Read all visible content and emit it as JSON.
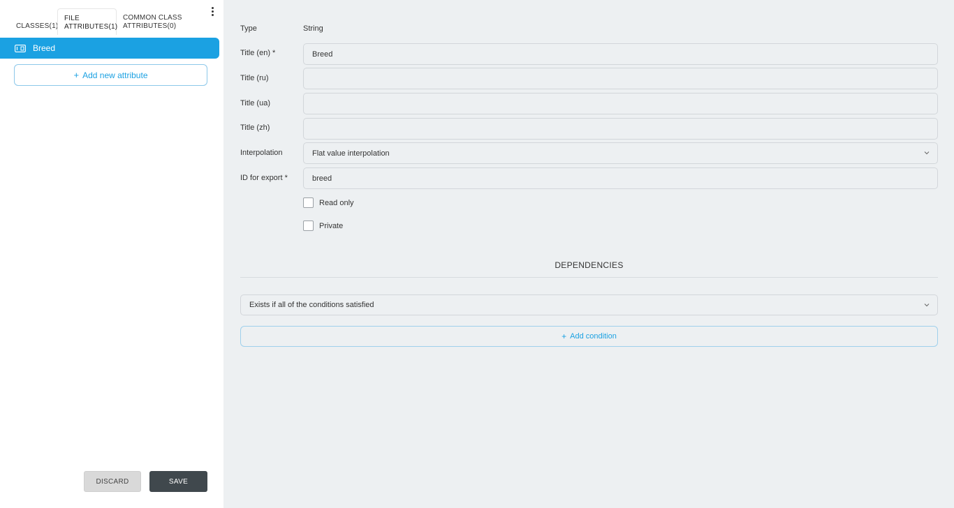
{
  "tabs": {
    "classes": {
      "line1": "CLASSES(1)"
    },
    "file_attributes": {
      "line1": "FILE",
      "line2": "ATTRIBUTES(1)"
    },
    "common_class_attributes": {
      "line1": "COMMON CLASS",
      "line2": "ATTRIBUTES(0)"
    },
    "active": "file_attributes"
  },
  "attributes": [
    {
      "label": "Breed",
      "icon": "attribute-tag-icon",
      "selected": true
    }
  ],
  "add_attribute_label": "Add new attribute",
  "footer": {
    "discard_label": "DISCARD",
    "save_label": "SAVE"
  },
  "form": {
    "type": {
      "label": "Type",
      "value": "String"
    },
    "title_en": {
      "label": "Title (en) *",
      "value": "Breed"
    },
    "title_ru": {
      "label": "Title (ru)",
      "value": ""
    },
    "title_ua": {
      "label": "Title (ua)",
      "value": ""
    },
    "title_zh": {
      "label": "Title (zh)",
      "value": ""
    },
    "interpolation": {
      "label": "Interpolation",
      "value": "Flat value interpolation"
    },
    "export_id": {
      "label": "ID for export *",
      "value": "breed"
    },
    "read_only": {
      "label": "Read only",
      "checked": false
    },
    "private": {
      "label": "Private",
      "checked": false
    }
  },
  "dependencies": {
    "title": "DEPENDENCIES",
    "condition_mode": "Exists if all of the conditions satisfied",
    "add_condition_label": "Add condition"
  },
  "colors": {
    "accent": "#1ba1e2",
    "save_button": "#40484d",
    "panel_background": "#edf0f2"
  }
}
